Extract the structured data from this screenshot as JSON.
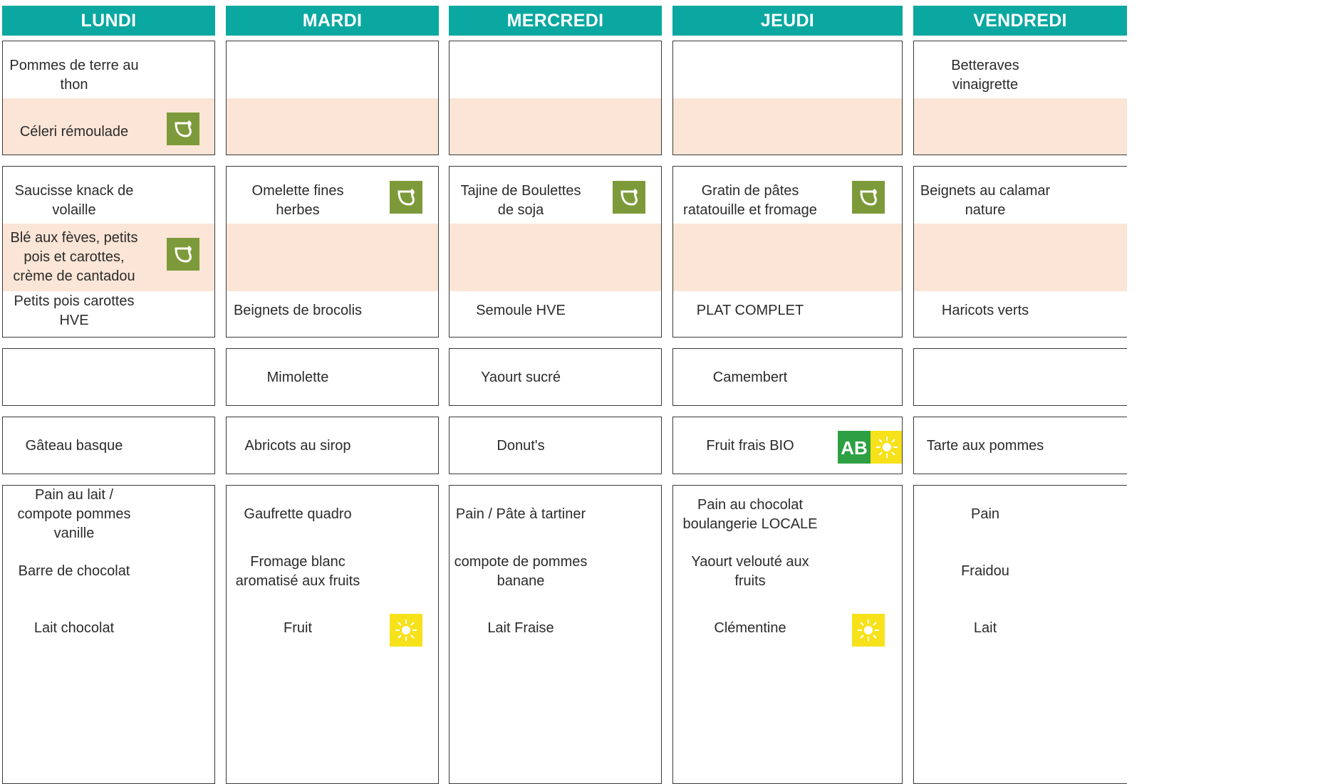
{
  "days": [
    "LUNDI",
    "MARDI",
    "MERCREDI",
    "JEUDI",
    "VENDREDI"
  ],
  "menu": {
    "lundi": {
      "entree_1": "Pommes de terre au thon",
      "entree_2": "Céleri rémoulade",
      "plat_1": "Saucisse knack de volaille",
      "plat_2": "Blé aux fèves, petits pois et carottes, crème de cantadou",
      "accompagnement": "Petits pois carottes HVE",
      "laitage": "",
      "dessert": "Gâteau basque",
      "gouter_1": "Pain au lait / compote pommes vanille",
      "gouter_2": "Barre de chocolat",
      "gouter_3": "Lait chocolat"
    },
    "mardi": {
      "entree_1": "",
      "entree_2": "",
      "plat_1": "Omelette fines herbes",
      "plat_2": "",
      "accompagnement": "Beignets de brocolis",
      "laitage": "Mimolette",
      "dessert": "Abricots au sirop",
      "gouter_1": "Gaufrette quadro",
      "gouter_2": "Fromage blanc aromatisé aux fruits",
      "gouter_3": "Fruit"
    },
    "mercredi": {
      "entree_1": "",
      "entree_2": "",
      "plat_1": "Tajine de Boulettes de soja",
      "plat_2": "",
      "accompagnement": "Semoule HVE",
      "laitage": "Yaourt sucré",
      "dessert": "Donut's",
      "gouter_1": "Pain / Pâte à tartiner",
      "gouter_2": "compote de pommes banane",
      "gouter_3": "Lait Fraise"
    },
    "jeudi": {
      "entree_1": "",
      "entree_2": "",
      "plat_1": "Gratin de pâtes ratatouille et fromage",
      "plat_2": "",
      "accompagnement": "PLAT COMPLET",
      "laitage": "Camembert",
      "dessert": "Fruit frais BIO",
      "gouter_1": "Pain au chocolat boulangerie LOCALE",
      "gouter_2": "Yaourt velouté aux fruits",
      "gouter_3": "Clémentine"
    },
    "vendredi": {
      "entree_1": "Betteraves vinaigrette",
      "entree_2": "",
      "plat_1": "Beignets au calamar nature",
      "plat_2": "",
      "accompagnement": "Haricots verts",
      "laitage": "",
      "dessert": "Tarte aux pommes",
      "gouter_1": "Pain",
      "gouter_2": "Fraidou",
      "gouter_3": "Lait"
    }
  },
  "icons": {
    "vegetarian": "leaf-icon",
    "seasonal": "sun-icon",
    "organic": "ab-organic-icon"
  },
  "colors": {
    "header": "#0aa8a1",
    "band": "#fbe5d6",
    "leaf": "#7d9a3a",
    "sun": "#f7e11a",
    "ab": "#2ea043"
  }
}
